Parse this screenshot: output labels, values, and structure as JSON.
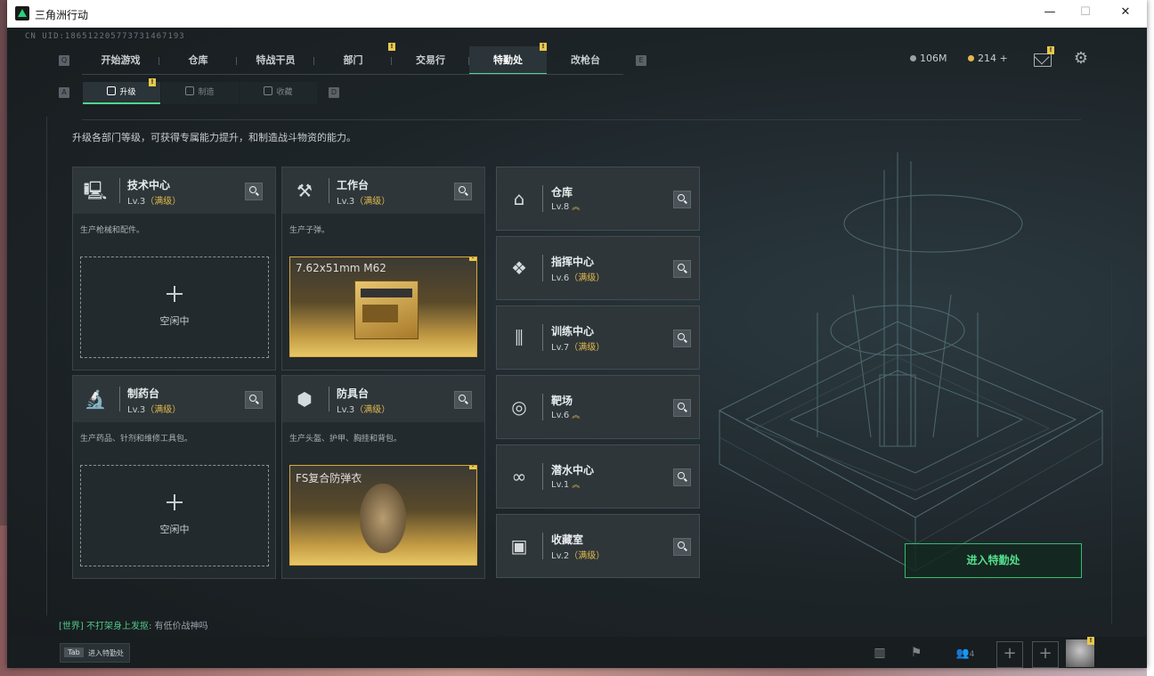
{
  "window": {
    "title": "三角洲行动",
    "controls": [
      "—",
      "☐",
      "✕"
    ]
  },
  "uid": "CN UID:186512205773731467193",
  "keys": {
    "left": "Q",
    "right": "E",
    "sub_left": "A",
    "sub_right": "D"
  },
  "top_tabs": [
    {
      "label": "开始游戏",
      "active": false,
      "badge": ""
    },
    {
      "label": "仓库",
      "active": false,
      "badge": ""
    },
    {
      "label": "特战干员",
      "active": false,
      "badge": ""
    },
    {
      "label": "部门",
      "active": false,
      "badge": "!"
    },
    {
      "label": "交易行",
      "active": false,
      "badge": ""
    },
    {
      "label": "特勤处",
      "active": true,
      "badge": "!"
    },
    {
      "label": "改枪台",
      "active": false,
      "badge": ""
    }
  ],
  "sub_tabs": [
    {
      "label": "升级",
      "active": true,
      "badge": "!"
    },
    {
      "label": "制造",
      "active": false,
      "badge": ""
    },
    {
      "label": "收藏",
      "active": false,
      "badge": ""
    }
  ],
  "resources": {
    "money": "106M",
    "coins": "214 +",
    "mail_badge": "!"
  },
  "description": "升级各部门等级，可获得专属能力提升，和制造战斗物资的能力。",
  "workshops": [
    {
      "name": "技术中心",
      "level": "Lv.3",
      "max": "（满级）",
      "desc": "生产枪械和配件。",
      "state": "idle",
      "idle_text": "空闲中",
      "icon": "computer-icon"
    },
    {
      "name": "工作台",
      "level": "Lv.3",
      "max": "（满级）",
      "desc": "生产子弹。",
      "state": "producing",
      "product": "7.62x51mm M62",
      "product_badge": "!",
      "icon": "tools-icon"
    },
    {
      "name": "制药台",
      "level": "Lv.3",
      "max": "（满级）",
      "desc": "生产药品、针剂和维修工具包。",
      "state": "idle",
      "idle_text": "空闲中",
      "icon": "microscope-icon"
    },
    {
      "name": "防具台",
      "level": "Lv.3",
      "max": "（满级）",
      "desc": "生产头盔、护甲、胸挂和背包。",
      "state": "producing",
      "product": "FS复合防弹衣",
      "product_badge": "!",
      "icon": "armor-icon"
    }
  ],
  "facilities": [
    {
      "name": "仓库",
      "level": "Lv.8",
      "max": "",
      "upgradable": true,
      "icon": "warehouse-icon"
    },
    {
      "name": "指挥中心",
      "level": "Lv.6",
      "max": "（满级）",
      "upgradable": false,
      "icon": "command-icon"
    },
    {
      "name": "训练中心",
      "level": "Lv.7",
      "max": "（满级）",
      "upgradable": false,
      "icon": "dumbbell-icon"
    },
    {
      "name": "靶场",
      "level": "Lv.6",
      "max": "",
      "upgradable": true,
      "icon": "target-icon"
    },
    {
      "name": "潜水中心",
      "level": "Lv.1",
      "max": "",
      "upgradable": true,
      "icon": "goggles-icon"
    },
    {
      "name": "收藏室",
      "level": "Lv.2",
      "max": "（满级）",
      "upgradable": false,
      "icon": "collection-icon"
    }
  ],
  "enter_button": "进入特勤处",
  "chat": {
    "channel": "[世界]",
    "user": "不打架身上发抠",
    "message": ": 有低价战神吗"
  },
  "bottom": {
    "tab_key": "Tab",
    "tab_label": "进入特勤处",
    "squad_count": "4",
    "avatar_badge": "!"
  },
  "colors": {
    "accent_green": "#4fd690",
    "max_gold": "#e1b94a",
    "badge_yellow": "#e8c94a"
  }
}
